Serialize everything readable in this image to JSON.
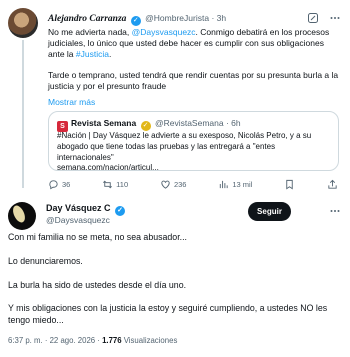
{
  "reply": {
    "display_name": "Alejandro Carranza",
    "handle": "@HombreJurista",
    "time": "· 3h",
    "text1_a": "No me advierta nada, ",
    "text1_mention": "@Daysvasquezc",
    "text1_b": ". Conmigo debatirá en los procesos judiciales, lo único que usted debe hacer es cumplir con sus obligaciones ante la ",
    "text1_hashtag": "#Justicia",
    "text1_end": ".",
    "text2": "Tarde o temprano, usted tendrá que rendir cuentas por su presunta burla a la justicia y por el presunto fraude",
    "show_more": "Mostrar más",
    "quote": {
      "logo_letter": "S",
      "source_name": "Revista Semana",
      "source_handle": "@RevistaSemana",
      "time": "· 6h",
      "text": "#Nación | Day Vásquez le advierte a su exesposo, Nicolás Petro, y a su abogado que tiene todas las pruebas y las entregará a \"entes internacionales\"",
      "link": "semana.com/nacion/articul..."
    },
    "actions": {
      "replies": "36",
      "retweets": "110",
      "likes": "236",
      "views": "13 mil"
    }
  },
  "main": {
    "display_name": "Day Vásquez C",
    "handle": "@Daysvasquezc",
    "follow_label": "Seguir",
    "paragraphs": [
      "Con mi familia no se meta, no sea abusador...",
      "Lo denunciaremos.",
      "La burla ha sido de ustedes desde el día uno.",
      "Y mis obligaciones con la justicia la estoy y seguiré cumpliendo, a ustedes NO les tengo miedo..."
    ],
    "timestamp": "6:37 p. m. · 22 ago. 2026 · ",
    "views_count": "1.776",
    "views_label": " Visualizaciones"
  },
  "colors": {
    "accent": "#1d9bf0",
    "text": "#0f1419",
    "muted": "#536471",
    "border": "#cfd9de",
    "semana_red": "#d6283b"
  },
  "icons": [
    "verified-badge-icon",
    "grok-icon",
    "more-icon",
    "reply-icon",
    "retweet-icon",
    "like-icon",
    "views-icon",
    "bookmark-icon",
    "share-icon"
  ]
}
